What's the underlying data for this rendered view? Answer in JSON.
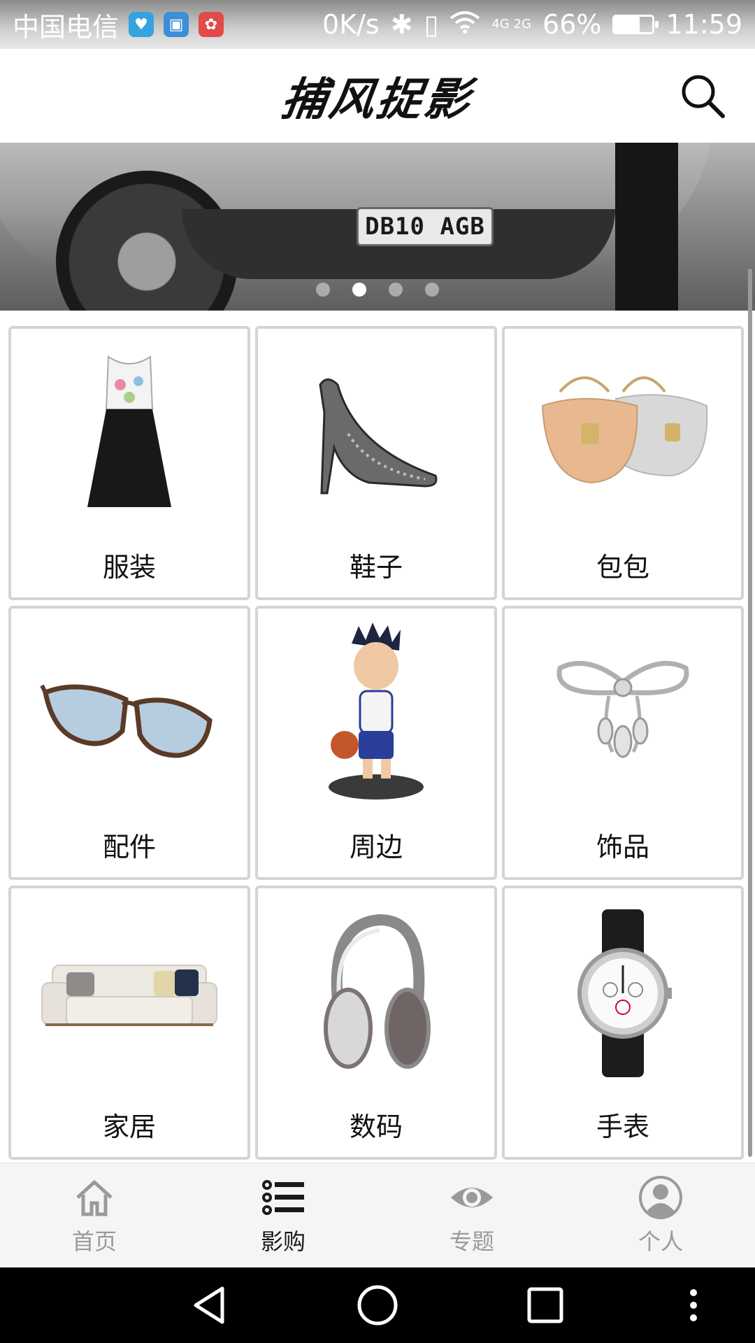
{
  "status_bar": {
    "carrier": "中国电信",
    "net_speed": "0K/s",
    "network": "4G 2G",
    "battery": "66%",
    "battery_level": 0.66,
    "time": "11:59"
  },
  "header": {
    "logo_text": "捕风捉影",
    "search_icon": "search-icon"
  },
  "banner": {
    "plate_text": "DB10 AGB",
    "slide_count": 4,
    "active_slide": 2
  },
  "categories": [
    {
      "label": "服装",
      "icon": "dress-icon"
    },
    {
      "label": "鞋子",
      "icon": "high-heel-icon"
    },
    {
      "label": "包包",
      "icon": "handbag-icon"
    },
    {
      "label": "配件",
      "icon": "sunglasses-icon"
    },
    {
      "label": "周边",
      "icon": "figurine-icon"
    },
    {
      "label": "饰品",
      "icon": "brooch-icon"
    },
    {
      "label": "家居",
      "icon": "sofa-icon"
    },
    {
      "label": "数码",
      "icon": "headphones-icon"
    },
    {
      "label": "手表",
      "icon": "watch-icon"
    }
  ],
  "tabs": [
    {
      "label": "首页",
      "icon": "home-icon",
      "active": false
    },
    {
      "label": "影购",
      "icon": "list-icon",
      "active": true
    },
    {
      "label": "专题",
      "icon": "eye-icon",
      "active": false
    },
    {
      "label": "个人",
      "icon": "user-icon",
      "active": false
    }
  ],
  "nav_bar": {
    "buttons": [
      "back-icon",
      "home-circle-icon",
      "recents-icon",
      "more-icon"
    ]
  }
}
